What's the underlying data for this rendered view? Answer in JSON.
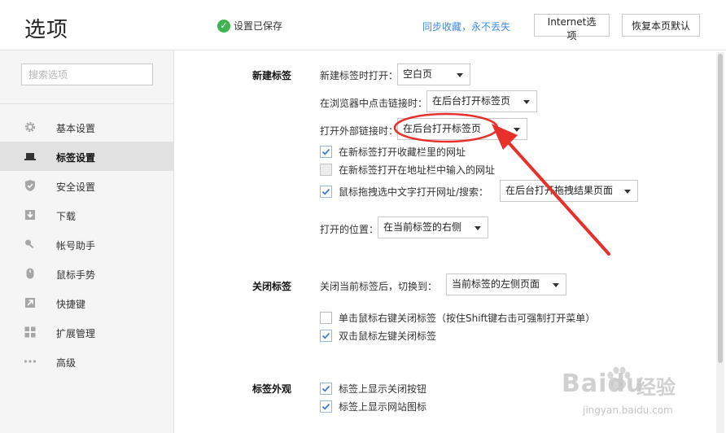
{
  "header": {
    "title": "选项",
    "saved_status": "设置已保存",
    "sync_link": "同步收藏，永不丢失",
    "internet_options_button": "Internet选项",
    "restore_defaults_button": "恢复本页默认"
  },
  "sidebar": {
    "search_placeholder": "搜索选项",
    "items": [
      {
        "label": "基本设置",
        "icon": "gear-icon"
      },
      {
        "label": "标签设置",
        "icon": "laptop-icon"
      },
      {
        "label": "安全设置",
        "icon": "shield-icon"
      },
      {
        "label": "下载",
        "icon": "download-icon"
      },
      {
        "label": "帐号助手",
        "icon": "key-icon"
      },
      {
        "label": "鼠标手势",
        "icon": "mouse-icon"
      },
      {
        "label": "快捷键",
        "icon": "arrow-icon"
      },
      {
        "label": "扩展管理",
        "icon": "grid-icon"
      },
      {
        "label": "高级",
        "icon": "more-icon"
      }
    ],
    "active_index": 1
  },
  "new_tab": {
    "section_title": "新建标签",
    "on_new_tab_label": "新建标签时打开：",
    "on_new_tab_value": "空白页",
    "click_link_label": "在浏览器中点击链接时：",
    "click_link_value": "在后台打开标签页",
    "external_link_label": "打开外部链接时：",
    "external_link_value": "在后台打开标签页",
    "checkboxes": [
      {
        "label": "在新标签打开收藏栏里的网址",
        "checked": true
      },
      {
        "label": "在新标签打开在地址栏中输入的网址",
        "checked": false
      },
      {
        "label": "鼠标拖拽选中文字打开网址/搜索：",
        "checked": true
      }
    ],
    "drag_search_value": "在后台打开拖拽结果页面",
    "open_position_label": "打开的位置：",
    "open_position_value": "在当前标签的右侧"
  },
  "close_tab": {
    "section_title": "关闭标签",
    "after_close_label": "关闭当前标签后，切换到：",
    "after_close_value": "当前标签的左侧页面",
    "checkboxes": [
      {
        "label": "单击鼠标右键关闭标签（按住Shift键右击可强制打开菜单）",
        "checked": false
      },
      {
        "label": "双击鼠标左键关闭标签",
        "checked": true
      }
    ]
  },
  "tab_appearance": {
    "section_title": "标签外观",
    "checkboxes": [
      {
        "label": "标签上显示关闭按钮",
        "checked": true
      },
      {
        "label": "标签上显示网站图标",
        "checked": true
      }
    ]
  },
  "watermark": {
    "brand": "Baidu",
    "suffix": "经验",
    "url": "jingyan.baidu.com"
  },
  "colors": {
    "accent_link": "#3d8ce3",
    "success": "#3fb34f",
    "annotation": "#e8302a",
    "checkmark": "#3d7fd4"
  }
}
